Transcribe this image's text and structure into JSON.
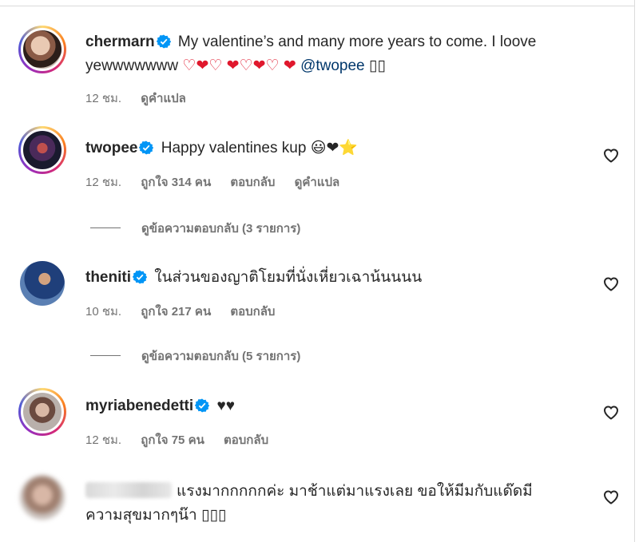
{
  "colors": {
    "accent_blue": "#0095f6",
    "mention": "#00376b",
    "heart_red": "#e0182d",
    "muted": "#737373"
  },
  "comments": [
    {
      "username": "chermarn",
      "text": "My valentine’s and many more years to come. I loove yewwwwwww",
      "hearts": "♡❤♡ ❤♡❤♡ ❤",
      "mention": "@twopee",
      "trailing": "▯▯",
      "time": "12 ชม.",
      "translate": "ดูคำแปล",
      "is_caption": true
    },
    {
      "username": "twopee",
      "text": "Happy valentines kup",
      "emojis": "😃❤⭐",
      "time": "12 ชม.",
      "likes": "ถูกใจ 314 คน",
      "reply": "ตอบกลับ",
      "translate": "ดูคำแปล",
      "view_replies": "ดูข้อความตอบกลับ (3 รายการ)"
    },
    {
      "username": "theniti",
      "text": "ในส่วนของญาติโยมที่นั่งเหี่ยวเฉาน้นนนน",
      "time": "10 ชม.",
      "likes": "ถูกใจ 217 คน",
      "reply": "ตอบกลับ",
      "view_replies": "ดูข้อความตอบกลับ (5 รายการ)"
    },
    {
      "username": "myriabenedetti",
      "text": "♥♥",
      "time": "12 ชม.",
      "likes": "ถูกใจ 75 คน",
      "reply": "ตอบกลับ"
    },
    {
      "username_hidden": true,
      "text_line1": "แรงมากกกกกค่ะ มาช้าแต่มาแรงเลย ขอให้มีมกับแด๊ดมี",
      "text_line2": "ความสุขมากๆน๊า ▯▯▯"
    }
  ],
  "icons": {
    "verified": "verified-badge-icon",
    "like": "heart-outline-icon"
  }
}
